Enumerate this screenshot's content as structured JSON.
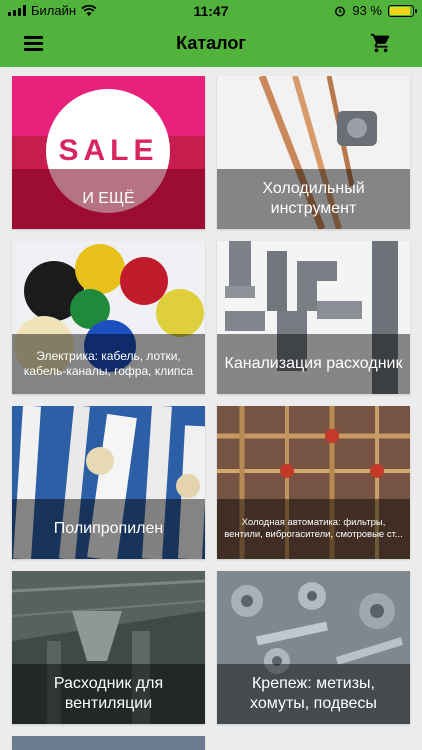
{
  "status": {
    "carrier": "Билайн",
    "time": "11:47",
    "battery": "93 %"
  },
  "nav": {
    "title": "Каталог",
    "menu_icon": "hamburger-menu-icon",
    "cart_icon": "shopping-cart-icon"
  },
  "colors": {
    "header": "#51b33b",
    "background": "#ececec"
  },
  "catalog": {
    "items": [
      {
        "label": "И ЕЩЁ",
        "sale_text": "SALE"
      },
      {
        "label": "Холодильный инструмент"
      },
      {
        "label": "Электрика: кабель, лотки, кабель-каналы, гофра, клипса"
      },
      {
        "label": "Канализация расходник"
      },
      {
        "label": "Полипропилен"
      },
      {
        "label": "Холодная автоматика: фильтры, вентили, виброгасители, смотровые ст..."
      },
      {
        "label": "Расходник для вентиляции"
      },
      {
        "label": "Крепеж: метизы, хомуты, подвесы"
      }
    ]
  }
}
